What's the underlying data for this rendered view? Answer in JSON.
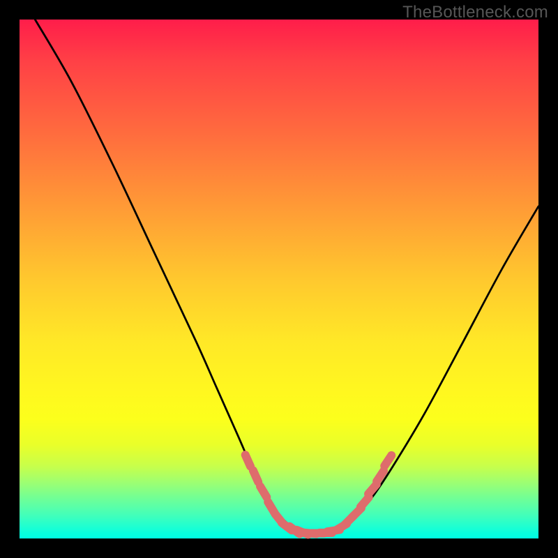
{
  "watermark": "TheBottleneck.com",
  "chart_data": {
    "type": "line",
    "title": "",
    "xlabel": "",
    "ylabel": "",
    "xlim": [
      0,
      100
    ],
    "ylim": [
      0,
      100
    ],
    "grid": false,
    "legend": false,
    "series": [
      {
        "name": "curve",
        "x_y": [
          [
            3,
            100
          ],
          [
            10,
            88
          ],
          [
            18,
            72
          ],
          [
            26,
            55
          ],
          [
            34,
            38
          ],
          [
            38,
            29
          ],
          [
            42,
            20
          ],
          [
            46,
            11
          ],
          [
            49,
            6
          ],
          [
            51,
            3.5
          ],
          [
            53,
            2
          ],
          [
            55,
            1.2
          ],
          [
            57,
            1
          ],
          [
            59,
            1
          ],
          [
            61,
            1.3
          ],
          [
            63,
            2.5
          ],
          [
            65,
            4.5
          ],
          [
            68,
            8
          ],
          [
            72,
            14
          ],
          [
            78,
            24
          ],
          [
            85,
            37
          ],
          [
            93,
            52
          ],
          [
            100,
            64
          ]
        ]
      }
    ],
    "markers": [
      {
        "x": 44.0,
        "y": 15.0
      },
      {
        "x": 45.5,
        "y": 12.0
      },
      {
        "x": 47.0,
        "y": 9.0
      },
      {
        "x": 48.5,
        "y": 6.0
      },
      {
        "x": 50.0,
        "y": 3.8
      },
      {
        "x": 51.5,
        "y": 2.3
      },
      {
        "x": 53.0,
        "y": 1.6
      },
      {
        "x": 54.5,
        "y": 1.2
      },
      {
        "x": 56.0,
        "y": 1.0
      },
      {
        "x": 57.5,
        "y": 1.0
      },
      {
        "x": 59.0,
        "y": 1.1
      },
      {
        "x": 60.5,
        "y": 1.5
      },
      {
        "x": 62.0,
        "y": 2.2
      },
      {
        "x": 63.5,
        "y": 3.5
      },
      {
        "x": 65.0,
        "y": 5.0
      },
      {
        "x": 66.5,
        "y": 7.0
      },
      {
        "x": 68.0,
        "y": 9.5
      },
      {
        "x": 69.5,
        "y": 12.0
      },
      {
        "x": 71.0,
        "y": 15.0
      }
    ],
    "colors": {
      "curve": "#000000",
      "marker_fill": "#de6c6c",
      "marker_stroke": "#de6c6c"
    }
  }
}
